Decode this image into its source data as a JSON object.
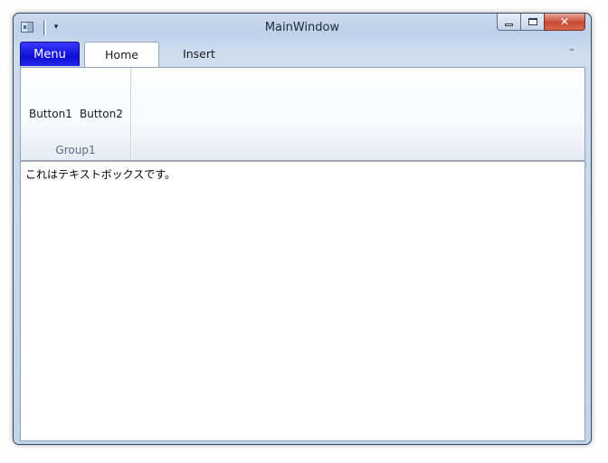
{
  "window": {
    "title": "MainWindow",
    "qat_dropdown_glyph": "▾",
    "close_glyph": "✕"
  },
  "icons": {
    "app": "window-icon",
    "minimize": "minimize-icon",
    "maximize": "maximize-icon",
    "close": "close-icon",
    "collapse_ribbon": "chevron-up-icon"
  },
  "ribbon": {
    "menu_label": "Menu",
    "tabs": [
      {
        "label": "Home",
        "selected": true
      },
      {
        "label": "Insert",
        "selected": false
      }
    ],
    "groups": [
      {
        "label": "Group1",
        "buttons": [
          "Button1",
          "Button2"
        ]
      }
    ],
    "collapse_glyph": "⌃"
  },
  "textbox": {
    "value": "これはテキストボックスです。"
  },
  "colors": {
    "menu_button": "#1a1af0",
    "close_button": "#c84b34",
    "frame": "#c2d4ea"
  }
}
